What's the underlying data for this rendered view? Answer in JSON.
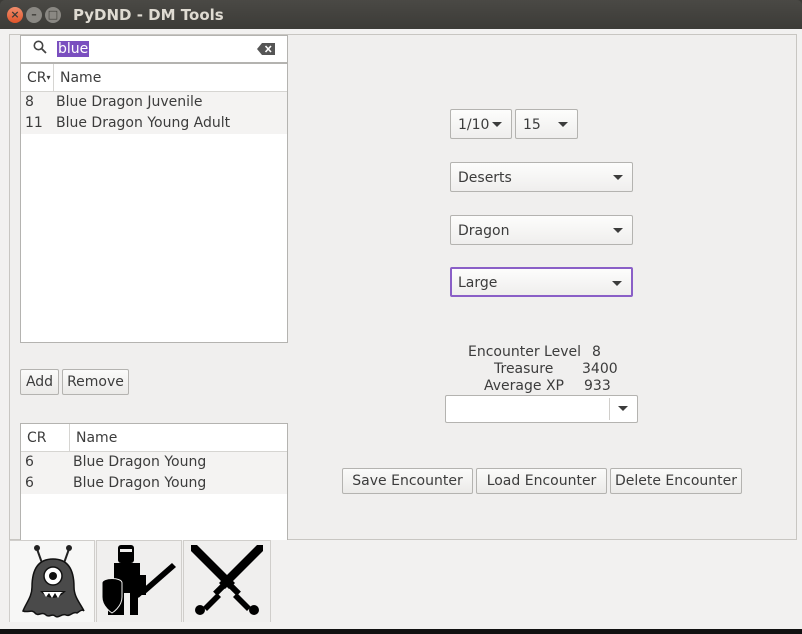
{
  "window": {
    "title": "PyDND - DM Tools"
  },
  "search": {
    "query": "blue"
  },
  "monster_table": {
    "headers": {
      "cr": "CR",
      "name": "Name"
    },
    "rows": [
      {
        "cr": "8",
        "name": "Blue Dragon Juvenile"
      },
      {
        "cr": "11",
        "name": "Blue Dragon Young Adult"
      }
    ]
  },
  "list_buttons": {
    "add": "Add",
    "remove": "Remove"
  },
  "encounter_table": {
    "headers": {
      "cr": "CR",
      "name": "Name"
    },
    "rows": [
      {
        "cr": "6",
        "name": "Blue Dragon Young"
      },
      {
        "cr": "6",
        "name": "Blue Dragon Young"
      }
    ]
  },
  "filters": {
    "cr_min": "1/10",
    "cr_max": "15",
    "environment": "Deserts",
    "type": "Dragon",
    "size": "Large"
  },
  "encounter_info": {
    "level_label": "Encounter Level",
    "level_value": "8",
    "treasure_label": "Treasure",
    "treasure_value": "3400",
    "xp_label": "Average XP",
    "xp_value": "933"
  },
  "saved_encounter": {
    "selected": ""
  },
  "encounter_buttons": {
    "save": "Save Encounter",
    "load": "Load Encounter",
    "delete": "Delete Encounter"
  },
  "tabs": [
    {
      "icon": "monster-icon"
    },
    {
      "icon": "knight-icon"
    },
    {
      "icon": "crossed-swords-icon"
    }
  ]
}
